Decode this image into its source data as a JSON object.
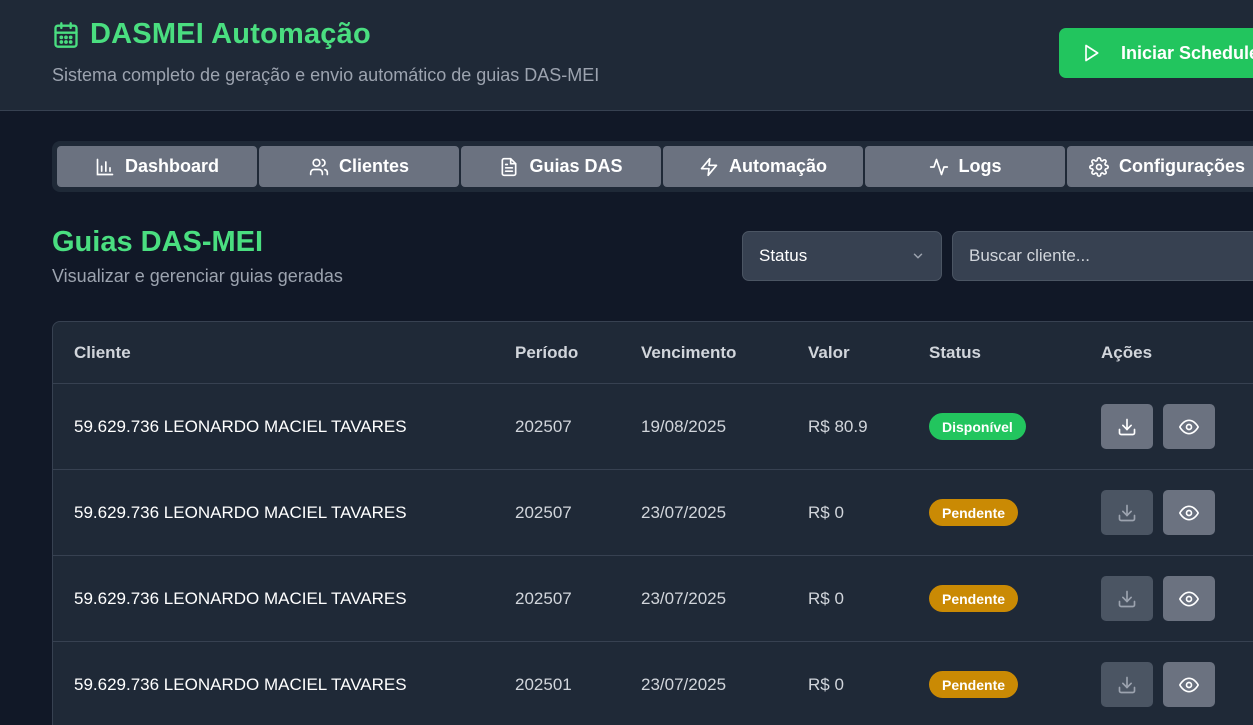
{
  "header": {
    "title": "DASMEI Automação",
    "subtitle": "Sistema completo de geração e envio automático de guias DAS-MEI",
    "title_icon": "calendar-icon",
    "scheduler_button": "Iniciar Scheduler"
  },
  "tabs": [
    {
      "label": "Dashboard",
      "icon": "bar-chart-icon"
    },
    {
      "label": "Clientes",
      "icon": "users-icon"
    },
    {
      "label": "Guias DAS",
      "icon": "file-text-icon"
    },
    {
      "label": "Automação",
      "icon": "lightning-icon"
    },
    {
      "label": "Logs",
      "icon": "activity-icon"
    },
    {
      "label": "Configurações",
      "icon": "gear-icon"
    }
  ],
  "section": {
    "title": "Guias DAS-MEI",
    "subtitle": "Visualizar e gerenciar guias geradas"
  },
  "filters": {
    "status_label": "Status",
    "search_placeholder": "Buscar cliente..."
  },
  "table": {
    "headers": {
      "client": "Cliente",
      "period": "Período",
      "due": "Vencimento",
      "value": "Valor",
      "status": "Status",
      "actions": "Ações"
    },
    "rows": [
      {
        "client": "59.629.736 LEONARDO MACIEL TAVARES",
        "period": "202507",
        "due": "19/08/2025",
        "value": "R$ 80.9",
        "status": "Disponível",
        "status_color": "#22c55e"
      },
      {
        "client": "59.629.736 LEONARDO MACIEL TAVARES",
        "period": "202507",
        "due": "23/07/2025",
        "value": "R$ 0",
        "status": "Pendente",
        "status_color": "#ca8a04"
      },
      {
        "client": "59.629.736 LEONARDO MACIEL TAVARES",
        "period": "202507",
        "due": "23/07/2025",
        "value": "R$ 0",
        "status": "Pendente",
        "status_color": "#ca8a04"
      },
      {
        "client": "59.629.736 LEONARDO MACIEL TAVARES",
        "period": "202501",
        "due": "23/07/2025",
        "value": "R$ 0",
        "status": "Pendente",
        "status_color": "#ca8a04"
      }
    ]
  },
  "colors": {
    "accent": "#4ade80",
    "primary_button": "#22c55e",
    "background": "#111827",
    "panel": "#1f2937"
  }
}
